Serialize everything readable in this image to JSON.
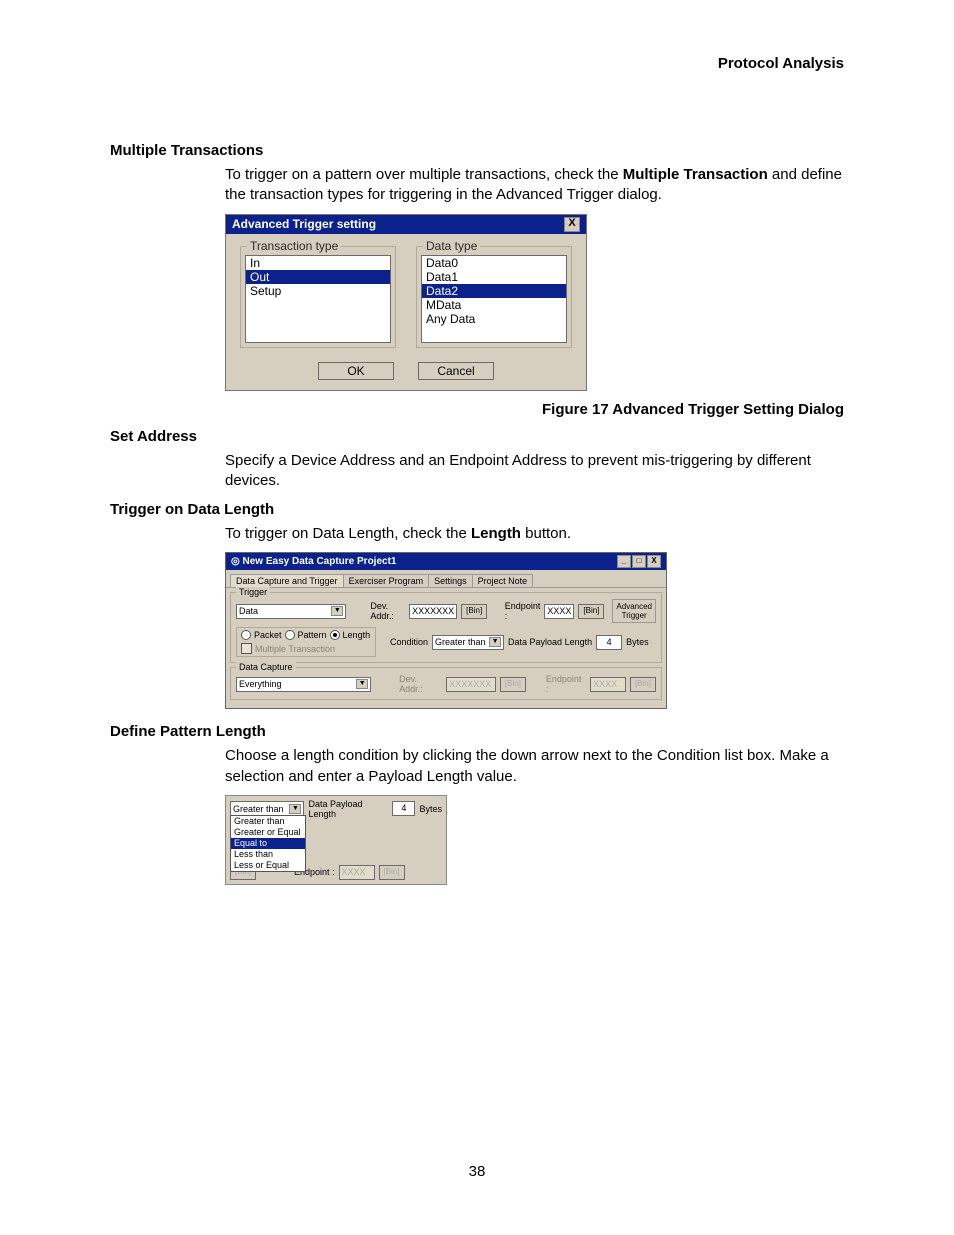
{
  "header": {
    "title": "Protocol Analysis"
  },
  "page_number": "38",
  "sec_mt": {
    "heading": "Multiple Transactions",
    "p_before": "To trigger on a pattern over multiple transactions, check the ",
    "bold1": "Multiple Transaction",
    "p_after": " and define the transaction types for triggering in the Advanced Trigger dialog."
  },
  "fig1": {
    "title": "Advanced Trigger setting",
    "close": "X",
    "trans_legend": "Transaction type",
    "trans_items": [
      "In",
      "Out",
      "Setup"
    ],
    "trans_sel": "Out",
    "data_legend": "Data type",
    "data_items": [
      "Data0",
      "Data1",
      "Data2",
      "MData",
      "Any Data"
    ],
    "data_sel": "Data2",
    "ok": "OK",
    "cancel": "Cancel",
    "caption": "Figure  17  Advanced Trigger Setting Dialog"
  },
  "sec_sa": {
    "heading": "Set Address",
    "p": "Specify a Device Address and an Endpoint Address to prevent mis-triggering by different devices."
  },
  "sec_tdl": {
    "heading": "Trigger on Data Length",
    "p_before": "To trigger on Data Length, check the ",
    "bold": "Length",
    "p_after": " button."
  },
  "fig2": {
    "title": "New Easy Data Capture Project1",
    "min": "_",
    "max": "□",
    "close": "X",
    "tabs": [
      "Data Capture and Trigger",
      "Exerciser Program",
      "Settings",
      "Project Note"
    ],
    "trigger_legend": "Trigger",
    "trigger_dd": "Data",
    "dev_lbl": "Dev. Addr.:",
    "dev_val": "XXXXXXX",
    "bin": "[Bin]",
    "ep_lbl": "Endpoint :",
    "ep_val": "XXXX",
    "adv": "Advanced Trigger",
    "r_packet": "Packet",
    "r_pattern": "Pattern",
    "r_length": "Length",
    "chk_mt": "Multiple Transaction",
    "cond_lbl": "Condition",
    "cond_val": "Greater than",
    "dpl_lbl": "Data Payload Length",
    "dpl_val": "4",
    "bytes": "Bytes",
    "dc_legend": "Data Capture",
    "dc_dd": "Everything"
  },
  "sec_dpl": {
    "heading": "Define Pattern Length",
    "p": "Choose a length condition by clicking the down arrow next to the Condition list box. Make a selection and enter a Payload Length value."
  },
  "fig3": {
    "sel": "Greater than",
    "dpl_lbl": "Data Payload Length",
    "dpl_val": "4",
    "bytes": "Bytes",
    "options": [
      "Greater than",
      "Greater or Equal",
      "Equal to",
      "Less than",
      "Less or Equal"
    ],
    "opt_sel": "Equal to",
    "bin": "[Bin]",
    "ep_lbl": "Endpoint :",
    "ep_val": "XXXX"
  }
}
